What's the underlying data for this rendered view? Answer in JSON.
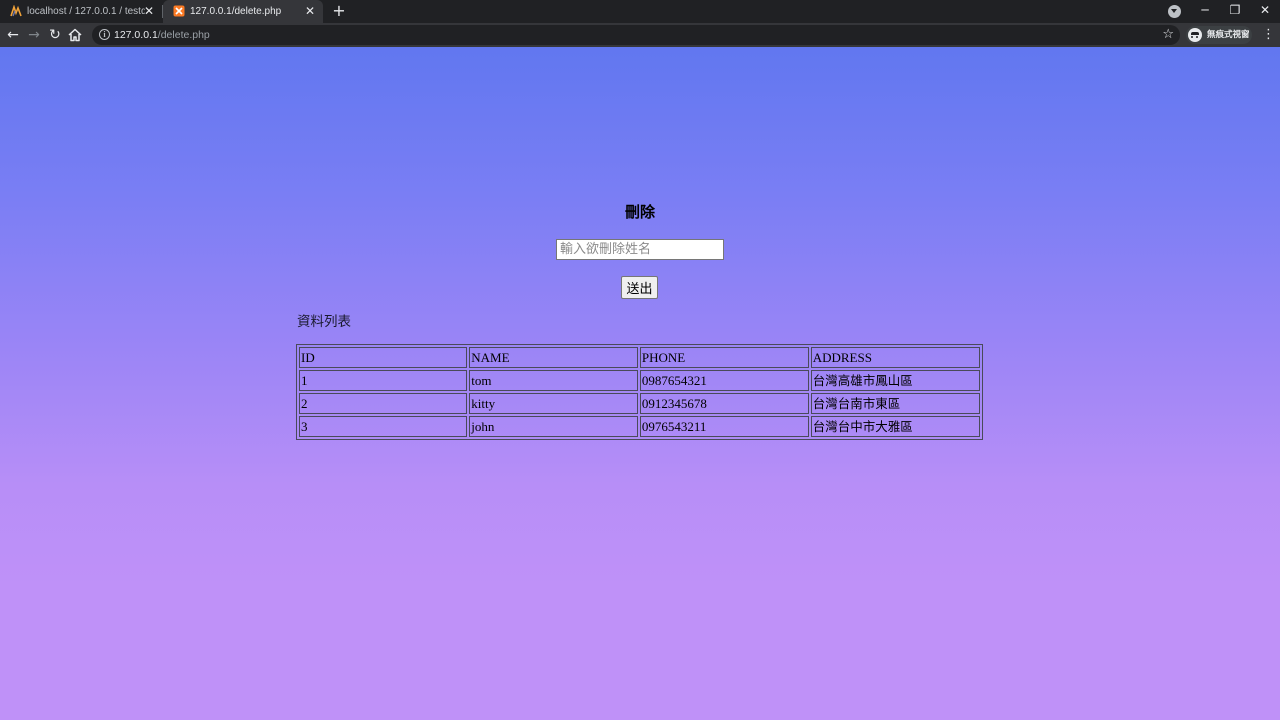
{
  "browser": {
    "tabs": [
      {
        "title": "localhost / 127.0.0.1 / testdb / ",
        "active": false,
        "favicon": "phpmyadmin-logo-icon"
      },
      {
        "title": "127.0.0.1/delete.php",
        "active": true,
        "favicon": "xampp-logo-icon"
      }
    ],
    "address": {
      "host": "127.0.0.1",
      "path": "/delete.php"
    },
    "profile_label": "無痕式視窗"
  },
  "page": {
    "heading": "刪除",
    "name_input": {
      "value": "",
      "placeholder": "輸入欲刪除姓名"
    },
    "submit_label": "送出",
    "list_label": "資料列表",
    "table": {
      "headers": [
        "ID",
        "NAME",
        "PHONE",
        "ADDRESS"
      ],
      "rows": [
        [
          "1",
          "tom",
          "0987654321",
          "台灣高雄市鳳山區"
        ],
        [
          "2",
          "kitty",
          "0912345678",
          "台灣台南市東區"
        ],
        [
          "3",
          "john",
          "0976543211",
          "台灣台中市大雅區"
        ]
      ]
    }
  },
  "colors": {
    "chrome_dark": "#202124",
    "toolbar": "#35363a",
    "gradient_top": "#6177f0",
    "gradient_bottom": "#bf91f8"
  }
}
